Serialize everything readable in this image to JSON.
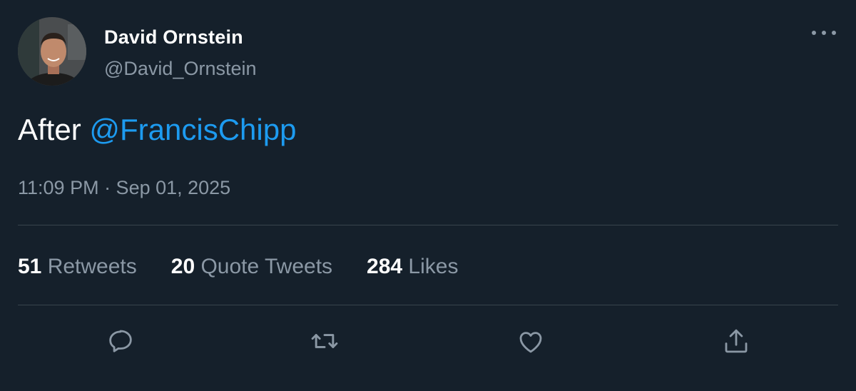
{
  "tweet": {
    "author": {
      "display_name": "David Ornstein",
      "handle": "@David_Ornstein"
    },
    "text_prefix": "After ",
    "mention": "@FrancisChipp",
    "timestamp": "11:09 PM · Sep 01, 2025"
  },
  "stats": {
    "retweets": {
      "count": "51",
      "label": " Retweets"
    },
    "quote_tweets": {
      "count": "20",
      "label": " Quote Tweets"
    },
    "likes": {
      "count": "284",
      "label": " Likes"
    }
  },
  "actions": {
    "icons": [
      "reply-icon",
      "retweet-icon",
      "like-icon",
      "share-icon"
    ]
  },
  "colors": {
    "background": "#15202b",
    "text_primary": "#ffffff",
    "text_secondary": "#8b98a5",
    "link": "#1d9bf0",
    "divider": "#38444d"
  }
}
